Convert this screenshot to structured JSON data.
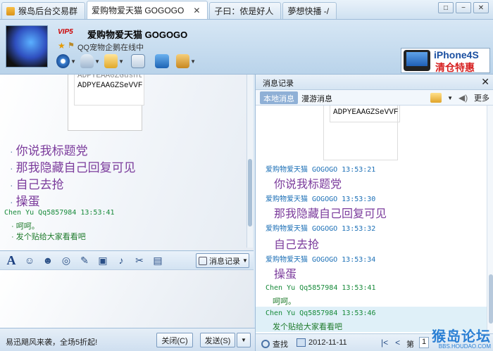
{
  "tabs": [
    {
      "label": "猴岛后台交易群",
      "active": false
    },
    {
      "label": "爱购物爱天猫 GOGOGO",
      "active": true
    },
    {
      "label": "子曰：侬是好人",
      "active": false
    },
    {
      "label": "夢想快播 -/",
      "active": false
    }
  ],
  "window_controls": {
    "restore": "□",
    "minimize": "−",
    "close": "✕"
  },
  "header": {
    "vip_badge": "VIP5",
    "contact_name": "爱购物爱天猫 GOGOGO",
    "status_text": "QQ宠物企鹅在线中",
    "tools": [
      "video-icon",
      "voice-icon",
      "transfer-file-icon",
      "add-contact-icon",
      "remote-assist-icon",
      "apps-icon"
    ]
  },
  "ad": {
    "line1": "iPhone4S",
    "line2": "清仓特惠"
  },
  "chat": {
    "img_line1": "ADPYEAA0ZGusnt",
    "img_line2": "ADPYEAAGZSeVVF",
    "big_messages": [
      "你说我标题党",
      "那我隐藏自己回复可见",
      "自己去抢",
      "操蛋"
    ],
    "sender": "Chen Yu Qq5857984  13:53:41",
    "small_messages": [
      "呵呵。",
      "发个贴给大家看看吧"
    ]
  },
  "input_toolbar": {
    "message_record_label": "消息记录"
  },
  "bottom": {
    "promo": "易迅飓风来袭，全场5折起!",
    "close_label": "关闭(C)",
    "send_label": "发送(S)"
  },
  "records": {
    "title": "消息记录",
    "tab_local": "本地消息",
    "tab_roam": "漫游消息",
    "more": "更多",
    "img_line": "ADPYEAAGZSeVVF",
    "entries": [
      {
        "meta": "爱购物爱天猫 GOGOGO  13:53:21",
        "text": "你说我标题党"
      },
      {
        "meta": "爱购物爱天猫 GOGOGO  13:53:30",
        "text": "那我隐藏自己回复可见"
      },
      {
        "meta": "爱购物爱天猫 GOGOGO  13:53:32",
        "text": "自己去抢"
      },
      {
        "meta": "爱购物爱天猫 GOGOGO  13:53:34",
        "text": "操蛋"
      },
      {
        "meta": "Chen Yu Qq5857984  13:53:41",
        "text": "呵呵。"
      },
      {
        "meta": "Chen Yu Qq5857984  13:53:46",
        "text": "发个贴给大家看看吧"
      }
    ],
    "search_label": "查找",
    "date": "2012-11-11",
    "page_label": "第",
    "page_value": "1"
  },
  "watermark": {
    "line1": "猴岛论坛",
    "line2": "BBS.HOUDAO.COM"
  }
}
